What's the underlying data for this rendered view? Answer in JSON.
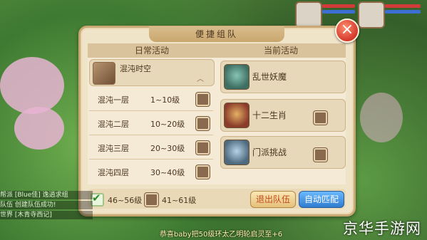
{
  "dialog": {
    "title": "便捷组队",
    "close_icon": "close-x",
    "daily_header": "日常活动",
    "current_header": "当前活动",
    "mode": {
      "name": "混沌时空",
      "caret": "︿"
    },
    "dungeons": [
      {
        "name": "混沌一层",
        "level": "1~10级"
      },
      {
        "name": "混沌二层",
        "level": "10~20级"
      },
      {
        "name": "混沌三层",
        "level": "20~30级"
      },
      {
        "name": "混沌四层",
        "level": "30~40级"
      }
    ],
    "current_activities": [
      {
        "name": "乱世妖魔"
      },
      {
        "name": "十二生肖"
      },
      {
        "name": "门派挑战"
      }
    ],
    "level_options": [
      {
        "label": "46~56级",
        "checked": true
      },
      {
        "label": "41~61级",
        "checked": false
      }
    ],
    "exit_button": "退出队伍",
    "auto_match_button": "自动匹配"
  },
  "chat": {
    "lines": [
      "帮派 [Blue佳] 逸逍求组",
      "队伍 创建队伍成功!",
      "世界 [木青寺西记]"
    ]
  },
  "banner": "恭喜baby把50级环太乙明轮启灵至+6",
  "watermark": "京华手游网"
}
